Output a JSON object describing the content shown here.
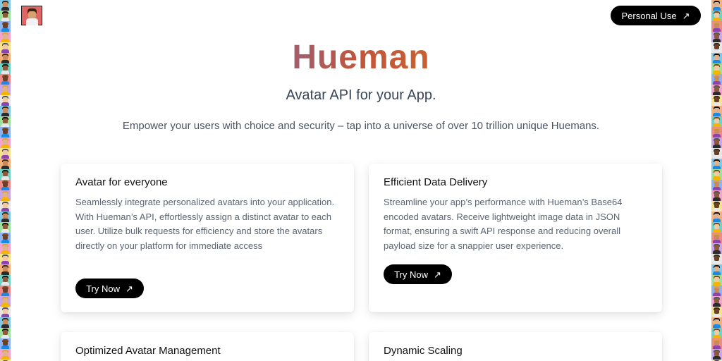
{
  "header": {
    "personal_use_label": "Personal Use",
    "arrow_glyph": "↗"
  },
  "hero": {
    "brand": "Hueman",
    "tagline": "Avatar API for your App.",
    "subtitle": "Empower your users with choice and security – tap into a universe of over 10 trillion unique Huemans."
  },
  "cards": [
    {
      "title": "Avatar for everyone",
      "text": "Seamlessly integrate personalized avatars into your application. With Hueman’s API, effortlessly assign a distinct avatar to each user. Utilize bulk requests for efficiency and store the avatars directly on your platform for immediate access",
      "button": "Try Now"
    },
    {
      "title": "Efficient Data Delivery",
      "text": "Streamline your app’s performance with Hueman’s Base64 encoded avatars. Receive lightweight image data in JSON format, ensuring a swift API response and reducing overall payload size for a snappier user experience.",
      "button": "Try Now"
    },
    {
      "title": "Optimized Avatar Management"
    },
    {
      "title": "Dynamic Scaling"
    }
  ],
  "theme": {
    "primary_button": "#000000",
    "strip_colors": [
      "#7fc8e8",
      "#f08a8a",
      "#f2e38c",
      "#9be29b",
      "#c9a6e8",
      "#f3b17c",
      "#8fb3f0",
      "#e6e6e6",
      "#6ed3c4",
      "#f4a3cf"
    ]
  }
}
